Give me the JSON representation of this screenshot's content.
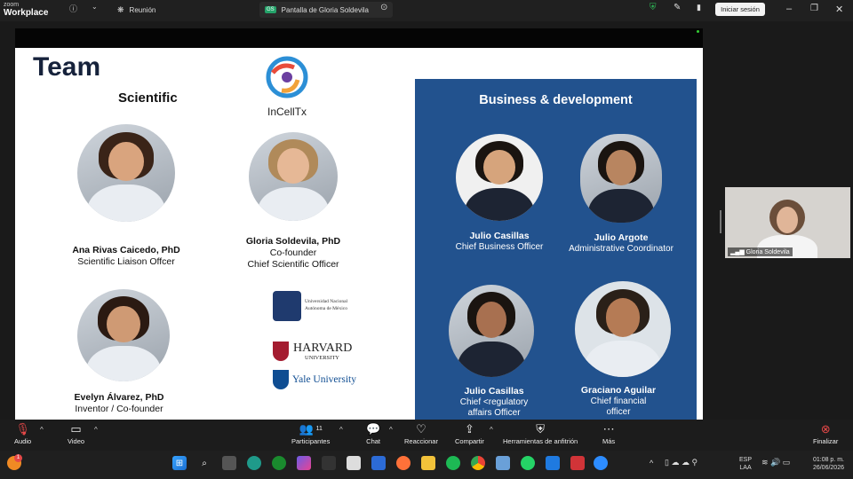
{
  "app": {
    "brand_small": "zoom",
    "brand": "Workplace",
    "tab_meeting": "Reunión",
    "tab_share_badge": "GS",
    "tab_share": "Pantalla de Gloria Soldevila",
    "signin": "Iniciar sesión"
  },
  "slide": {
    "title": "Team",
    "subtitle": "Scientific",
    "logo": "InCellTx",
    "people": [
      {
        "name": "Ana Rivas Caicedo, PhD",
        "role1": "Scientific Liaison Offcer",
        "role2": ""
      },
      {
        "name": "Gloria Soldevila, PhD",
        "role1": "Co-founder",
        "role2": "Chief Scientific Officer"
      },
      {
        "name": "Evelyn Álvarez, PhD",
        "role1": "Inventor / Co-founder",
        "role2": ""
      }
    ],
    "universities": {
      "unam1": "Universidad Nacional",
      "unam2": "Autónoma de México",
      "harvard": "HARVARD",
      "harvard_sub": "UNIVERSITY",
      "yale": "Yale University"
    },
    "bd": {
      "title": "Business & development",
      "people": [
        {
          "name": "Julio Casillas",
          "role1": "Chief Business Officer",
          "role2": ""
        },
        {
          "name": "Julio Argote",
          "role1": "Administrative Coordinator",
          "role2": ""
        },
        {
          "name": "Julio Casillas",
          "role1": "Chief <regulatory",
          "role2": "affairs  Officer"
        },
        {
          "name": "Graciano Aguilar",
          "role1": "Chief financial",
          "role2": "officer"
        }
      ]
    }
  },
  "participant": {
    "name": "Gloria Soldevila"
  },
  "toolbar": {
    "audio": "Audio",
    "video": "Video",
    "participants": "Participantes",
    "participants_count": "11",
    "chat": "Chat",
    "react": "Reaccionar",
    "share": "Compartir",
    "host": "Herramientas de anfitrión",
    "more": "Más",
    "end": "Finalizar"
  },
  "taskbar": {
    "lang1": "ESP",
    "lang2": "LAA",
    "time": "01:08 p. m.",
    "date": "26/06/2026",
    "notif": "1"
  },
  "colors": {
    "bd_panel": "#22528e",
    "title": "#16223b"
  }
}
